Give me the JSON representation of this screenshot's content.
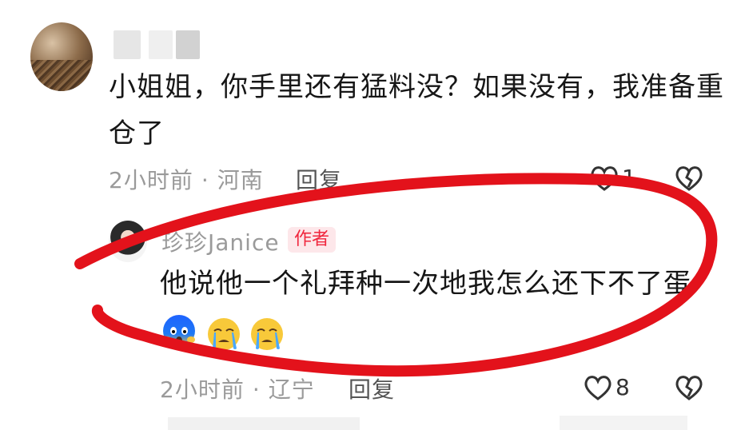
{
  "top_comment": {
    "avatar": "blurred-user-avatar",
    "text": "小姐姐，你手里还有猛料没？如果没有，我准备重仓了",
    "time": "2小时前",
    "separator": "·",
    "location": "河南",
    "reply_label": "回复",
    "likes": "1",
    "icons": {
      "like": "heart-outline-icon",
      "dislike": "broken-heart-icon"
    }
  },
  "author_reply": {
    "avatar": "author-avatar",
    "author": "珍珍Janice",
    "badge": "作者",
    "text": "他说他一个礼拜种一次地我怎么还下不了蛋",
    "emojis": [
      "scream-emoji",
      "crying-emoji",
      "crying-emoji"
    ],
    "time": "2小时前",
    "separator": "·",
    "location": "辽宁",
    "reply_label": "回复",
    "likes": "8",
    "icons": {
      "like": "heart-outline-icon",
      "dislike": "broken-heart-icon"
    }
  },
  "colors": {
    "annotation": "#e3121b",
    "badge_bg": "#fde7ea",
    "badge_text": "#f0263d",
    "meta_text": "#9a9a9a"
  }
}
